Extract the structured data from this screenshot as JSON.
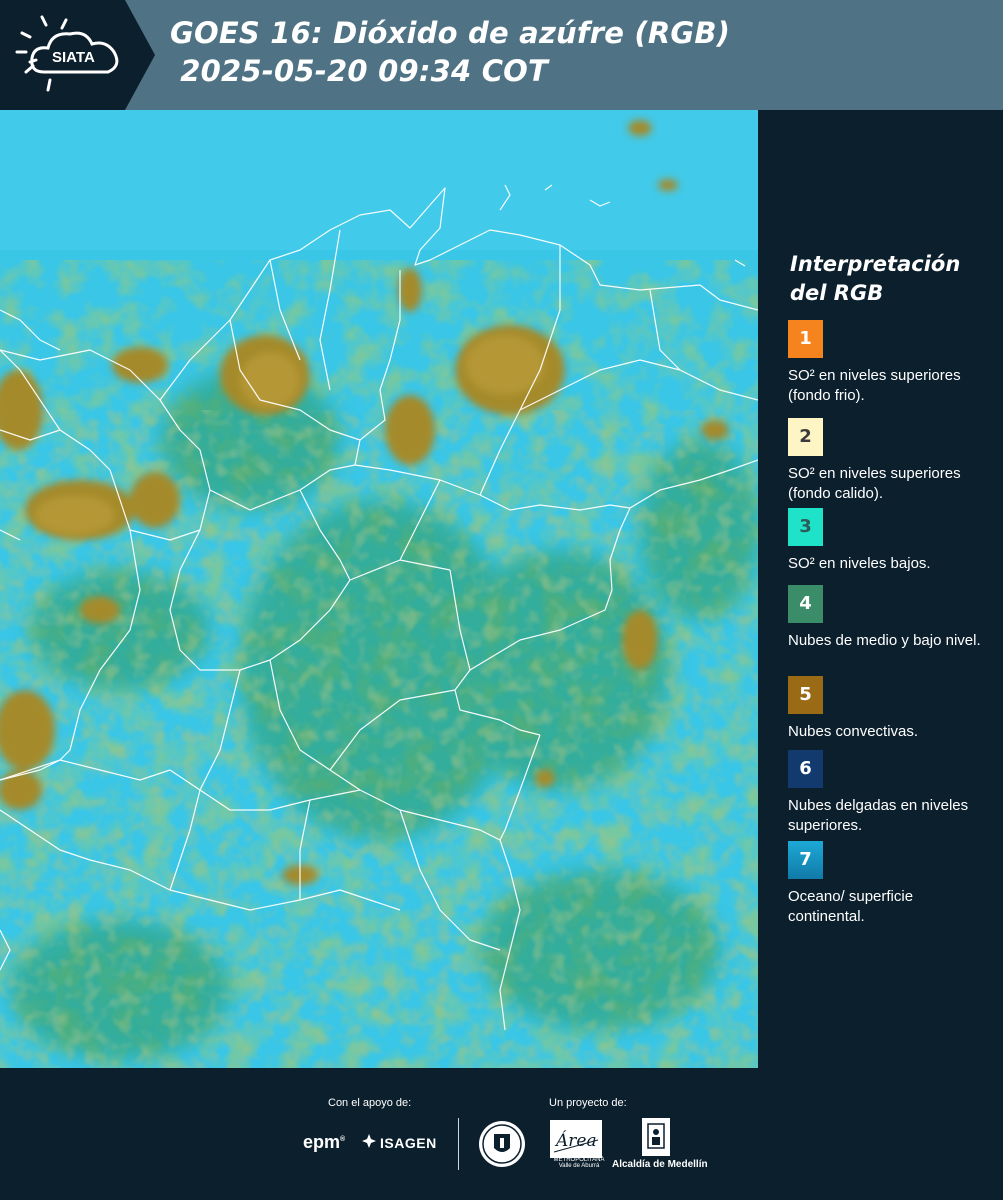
{
  "header": {
    "logo_text": "SIATA",
    "title_line1": "GOES 16: Dióxido de azúfre (RGB)",
    "title_line2": " 2025-05-20 09:34 COT",
    "background_color": "#4f7384",
    "logo_band_color": "#0c1f2d"
  },
  "legend": {
    "title_line1": "Interpretación",
    "title_line2": "del RGB",
    "items": [
      {
        "number": "1",
        "color": "#f5841f",
        "number_color": "#ffffff",
        "text": "SO² en niveles superiores (fondo frio)."
      },
      {
        "number": "2",
        "color": "#fdf6c4",
        "number_color": "#3a3a3a",
        "text": "SO² en niveles superiores (fondo calido)."
      },
      {
        "number": "3",
        "color": "#1fe3c8",
        "number_color": "#2a5c5c",
        "text": "SO² en niveles bajos."
      },
      {
        "number": "4",
        "color": "#3b8c68",
        "number_color": "#ffffff",
        "text": "Nubes de medio y bajo nivel."
      },
      {
        "number": "5",
        "color": "#9a6a14",
        "number_color": "#ffffff",
        "text": "Nubes convectivas."
      },
      {
        "number": "6",
        "color": "#123a6e",
        "number_color": "#ffffff",
        "text": "Nubes delgadas en niveles superiores."
      },
      {
        "number": "7",
        "color": "#1590c0",
        "number_color": "#ffffff",
        "text": "Oceano/ superficie continental."
      }
    ]
  },
  "map": {
    "ocean_color": "#38c4e4",
    "cloud_green": "#2f9a5e",
    "convective_color": "#a08a30",
    "border_color": "#ffffff"
  },
  "footer": {
    "support_label": "Con el apoyo de:",
    "project_label": "Un proyecto de:",
    "epm": "epm",
    "isagen": "ISAGEN",
    "amva_logo_text": "Área",
    "amva": "METROPOLITANA Valle de Aburrá",
    "alcaldia": "Alcaldía de Medellín"
  }
}
